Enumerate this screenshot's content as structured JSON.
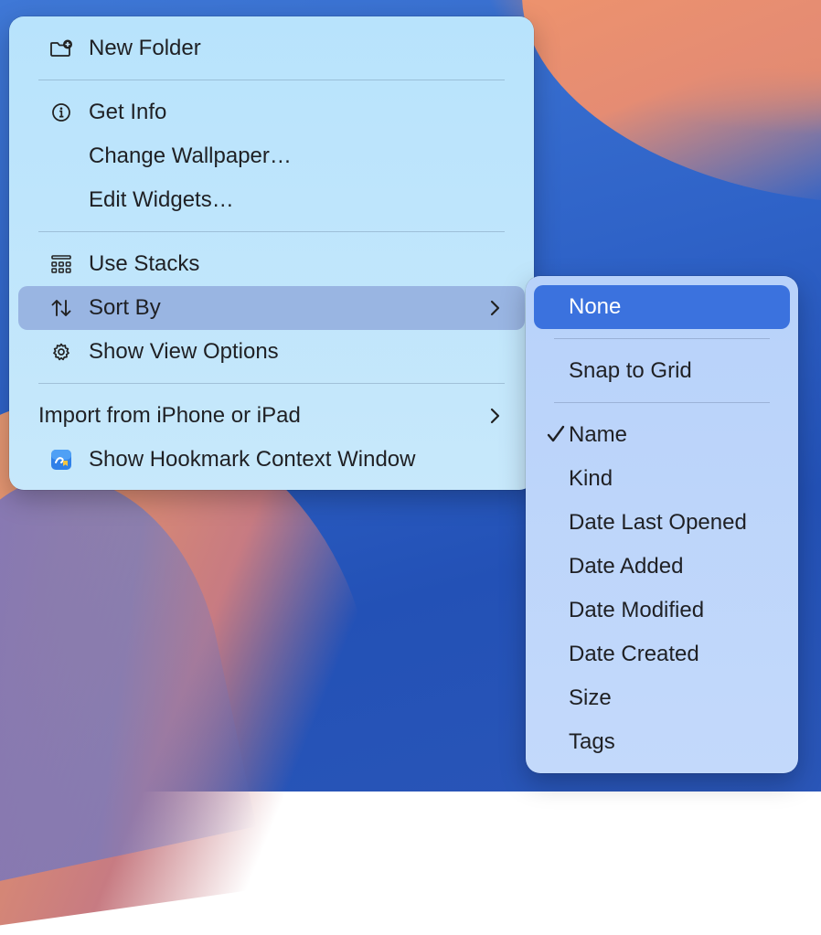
{
  "main_menu": {
    "new_folder": "New Folder",
    "get_info": "Get Info",
    "change_wallpaper": "Change Wallpaper…",
    "edit_widgets": "Edit Widgets…",
    "use_stacks": "Use Stacks",
    "sort_by": "Sort By",
    "show_view_options": "Show View Options",
    "import_from_iphone": "Import from iPhone or iPad",
    "show_hookmark": "Show Hookmark Context Window"
  },
  "sort_submenu": {
    "items": {
      "none": "None",
      "snap_to_grid": "Snap to Grid",
      "name": "Name",
      "kind": "Kind",
      "date_last_opened": "Date Last Opened",
      "date_added": "Date Added",
      "date_modified": "Date Modified",
      "date_created": "Date Created",
      "size": "Size",
      "tags": "Tags"
    },
    "checked": "Name",
    "highlighted": "None"
  },
  "colors": {
    "highlight_selected": "#3b72de",
    "hover_row": "#8a9ad0"
  }
}
